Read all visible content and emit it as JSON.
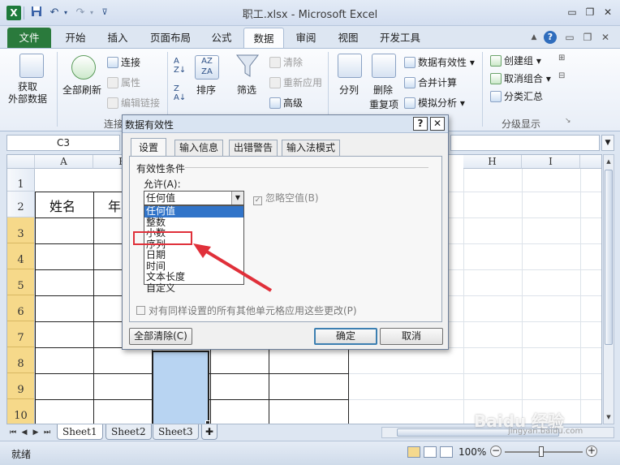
{
  "window": {
    "title": "职工.xlsx - Microsoft Excel",
    "app_icon": "X"
  },
  "ribbon_tabs": [
    "文件",
    "开始",
    "插入",
    "页面布局",
    "公式",
    "数据",
    "审阅",
    "视图",
    "开发工具"
  ],
  "active_tab": "数据",
  "ribbon": {
    "get_external_data": "获取\n外部数据",
    "refresh_all": "全部刷新",
    "connections": "连接",
    "properties": "属性",
    "edit_links": "编辑链接",
    "group_connections": "连接",
    "sort": "排序",
    "filter": "筛选",
    "clear": "清除",
    "reapply": "重新应用",
    "advanced": "高级",
    "text_to_columns": "分列",
    "remove_duplicates_1": "删除",
    "remove_duplicates_2": "重复项",
    "data_validation": "数据有效性",
    "consolidate": "合并计算",
    "what_if": "模拟分析",
    "group": "创建组",
    "ungroup": "取消组合",
    "subtotal": "分类汇总",
    "group_outline": "分级显示"
  },
  "namebox": "C3",
  "grid": {
    "columns": [
      "A",
      "B",
      "H",
      "I"
    ],
    "rows": [
      "1",
      "2",
      "3",
      "4",
      "5",
      "6",
      "7",
      "8",
      "9",
      "10"
    ],
    "cells": {
      "A2": "姓名",
      "B2": "年"
    }
  },
  "dialog": {
    "title": "数据有效性",
    "help_btn": "?",
    "close_btn": "✕",
    "tabs": [
      "设置",
      "输入信息",
      "出错警告",
      "输入法模式"
    ],
    "criteria_label": "有效性条件",
    "allow_label": "允许(A):",
    "allow_value": "任何值",
    "allow_options": [
      "任何值",
      "整数",
      "小数",
      "序列",
      "日期",
      "时间",
      "文本长度",
      "自定义"
    ],
    "ignore_blank": "忽略空值(B)",
    "apply_all": "对有同样设置的所有其他单元格应用这些更改(P)",
    "clear_all": "全部清除(C)",
    "ok": "确定",
    "cancel": "取消"
  },
  "sheets": [
    "Sheet1",
    "Sheet2",
    "Sheet3"
  ],
  "status": {
    "ready": "就绪",
    "zoom": "100%"
  },
  "watermark": {
    "brand": "Baidu 经验",
    "url": "jingyan.baidu.com"
  },
  "colors": {
    "file_tab": "#2a7a3c",
    "selection": "#b8d4f2",
    "highlight_option": "#3174c9",
    "annotation": "#e0303a",
    "row_header_selected": "#f6d98a"
  }
}
